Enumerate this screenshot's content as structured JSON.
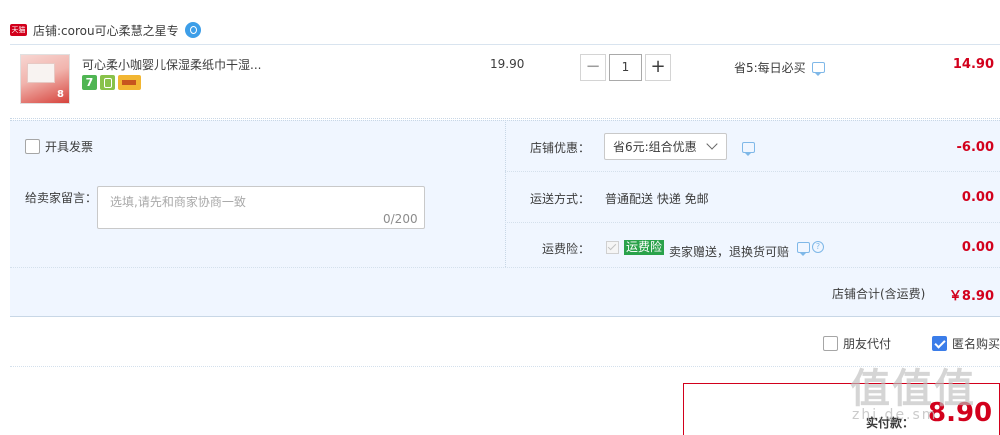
{
  "shop": {
    "badge": "天猫",
    "prefix": "店铺: ",
    "name": "corou可心柔慧之星专"
  },
  "item": {
    "title": "可心柔小咖婴儿保湿柔纸巾干湿...",
    "service_badge_1": "7",
    "unit_price": "19.90",
    "quantity": "1",
    "qty_minus": "−",
    "qty_plus": "+",
    "promo_text": "省5:每日必买",
    "total": "14.90"
  },
  "invoice": {
    "label": "开具发票"
  },
  "message": {
    "label": "给卖家留言：",
    "placeholder": "选填,请先和商家协商一致",
    "counter": "0/200"
  },
  "shop_promo": {
    "label": "店铺优惠：",
    "selected": "省6元:组合优惠",
    "value": "-6.00"
  },
  "shipping": {
    "label": "运送方式：",
    "value": "普通配送 快递 免邮",
    "amount": "0.00"
  },
  "insurance": {
    "label": "运费险：",
    "tag": "运费险",
    "desc": "卖家赠送，退换货可赔",
    "help_glyph": "?",
    "amount": "0.00"
  },
  "subtotal": {
    "label": "店铺合计(含运费)",
    "value": "￥8.90"
  },
  "options": {
    "friend_pay": "朋友代付",
    "anon_buy": "匿名购买"
  },
  "payment": {
    "label": "实付款：",
    "value": "8.90"
  },
  "watermark": {
    "text": "值值值",
    "sub": "zhi.de.sm"
  },
  "colors": {
    "accent_red": "#d2001c",
    "panel_bg": "#f0f6ff",
    "checkbox_blue": "#3b7de9",
    "insurance_green": "#2aa24a"
  }
}
